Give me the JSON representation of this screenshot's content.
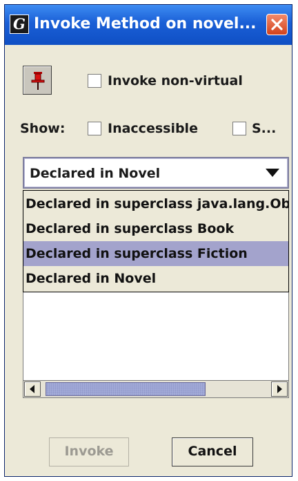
{
  "window": {
    "title": "Invoke Method on novel...",
    "app_icon_letter": "G",
    "icons": {
      "app": "app-g-icon",
      "close": "close-icon",
      "pin": "pushpin-icon"
    }
  },
  "options": {
    "invoke_nonvirtual_label": "Invoke non-virtual",
    "invoke_nonvirtual_checked": false,
    "show_label": "Show:",
    "inaccessible_label": "Inaccessible",
    "inaccessible_checked": false,
    "third_option_label": "S...",
    "third_option_checked": false
  },
  "declared_combo": {
    "selected_value": "Declared in Novel",
    "arrow_icon": "dropdown-arrow-icon",
    "options": [
      "Declared in superclass java.lang.Object",
      "Declared in superclass Book",
      "Declared in superclass Fiction",
      "Declared in Novel"
    ],
    "highlighted_index": 2
  },
  "scrollbar": {
    "left_icon": "scroll-left-icon",
    "right_icon": "scroll-right-icon"
  },
  "buttons": {
    "invoke_label": "Invoke",
    "invoke_enabled": false,
    "cancel_label": "Cancel"
  },
  "colors": {
    "titlebar": "#1a5fd6",
    "dialog_bg": "#ece9d8",
    "selection": "#a3a3cc",
    "close_button": "#d2421c"
  }
}
